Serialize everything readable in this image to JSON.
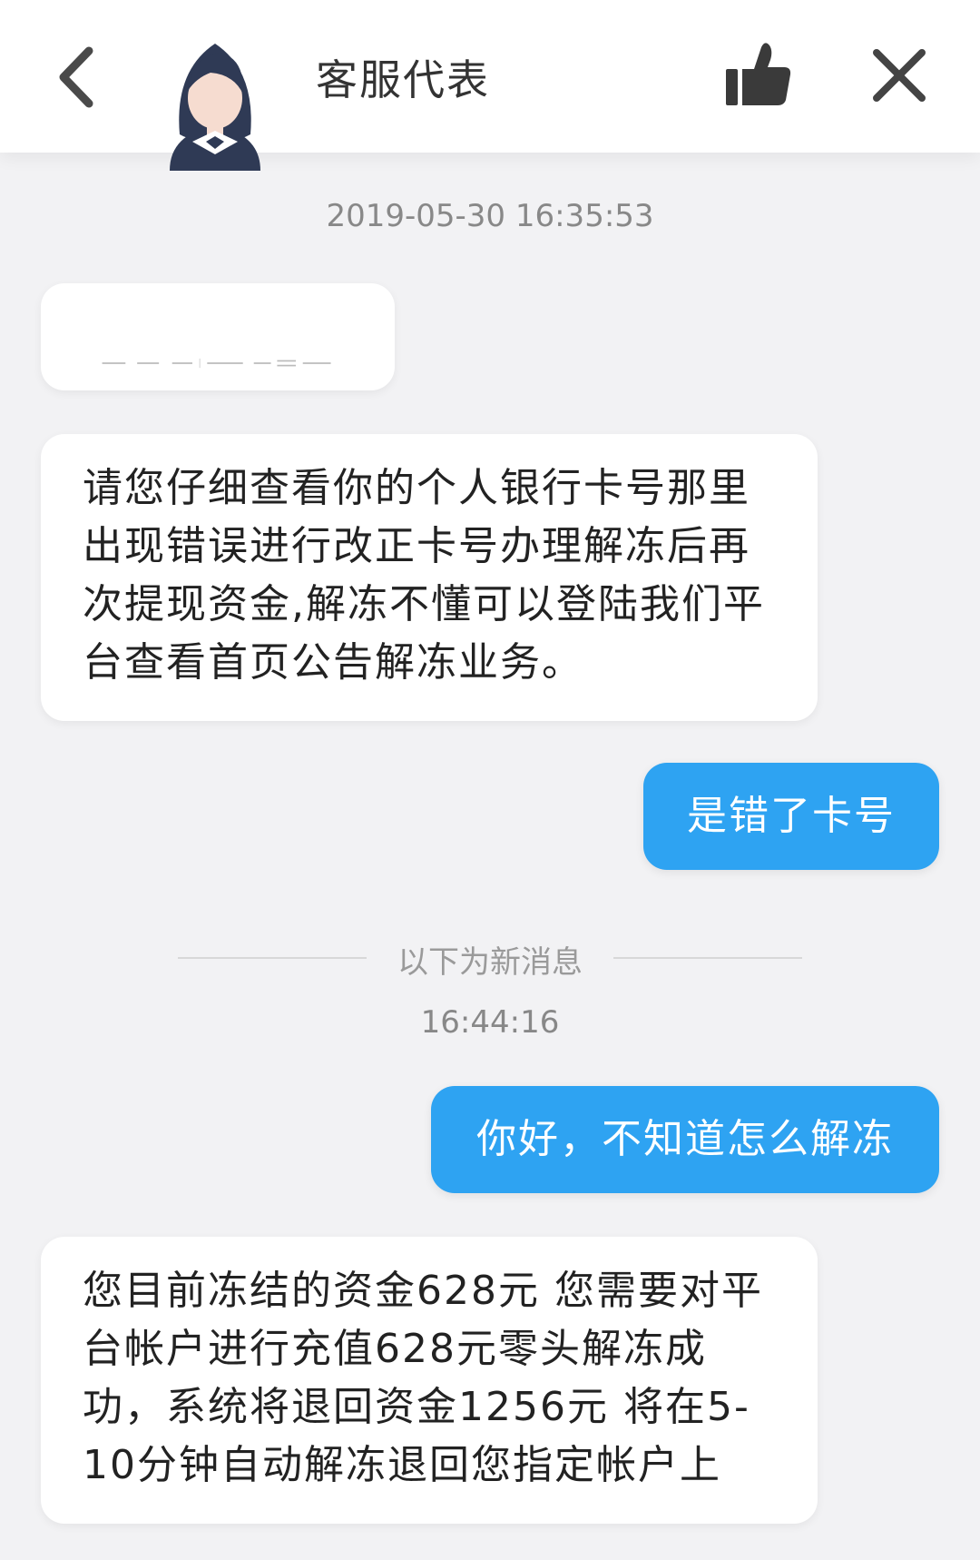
{
  "header": {
    "title": "客服代表",
    "icons": {
      "back": "chevron-left-icon",
      "like": "thumbs-up-icon",
      "close": "close-icon"
    }
  },
  "conversation": {
    "first_timestamp": "2019-05-30 16:35:53",
    "messages": [
      {
        "side": "left",
        "type": "image",
        "alt": ""
      },
      {
        "side": "left",
        "type": "text",
        "lines": [
          "请您仔细查看你的个人银行卡号那里",
          "出现错误进行改正卡号办理解冻后再",
          "次提现资金,解冻不懂可以登陆我们平",
          "台查看首页公告解冻业务。"
        ]
      },
      {
        "side": "right",
        "type": "text",
        "text": "是错了卡号"
      },
      {
        "side": "right",
        "type": "text",
        "text": "你好，不知道怎么解冻"
      },
      {
        "side": "left",
        "type": "text",
        "lines": [
          "您目前冻结的资金628元 您需要对平",
          "台帐户进行充值628元零头解冻成",
          "功，系统将退回资金1256元 将在5-",
          "10分钟自动解冻退回您指定帐户上"
        ]
      }
    ],
    "new_message_divider": "以下为新消息",
    "second_timestamp": "16:44:16"
  },
  "colors": {
    "accent_blue": "#2ea3f2",
    "background": "#f2f2f4"
  }
}
